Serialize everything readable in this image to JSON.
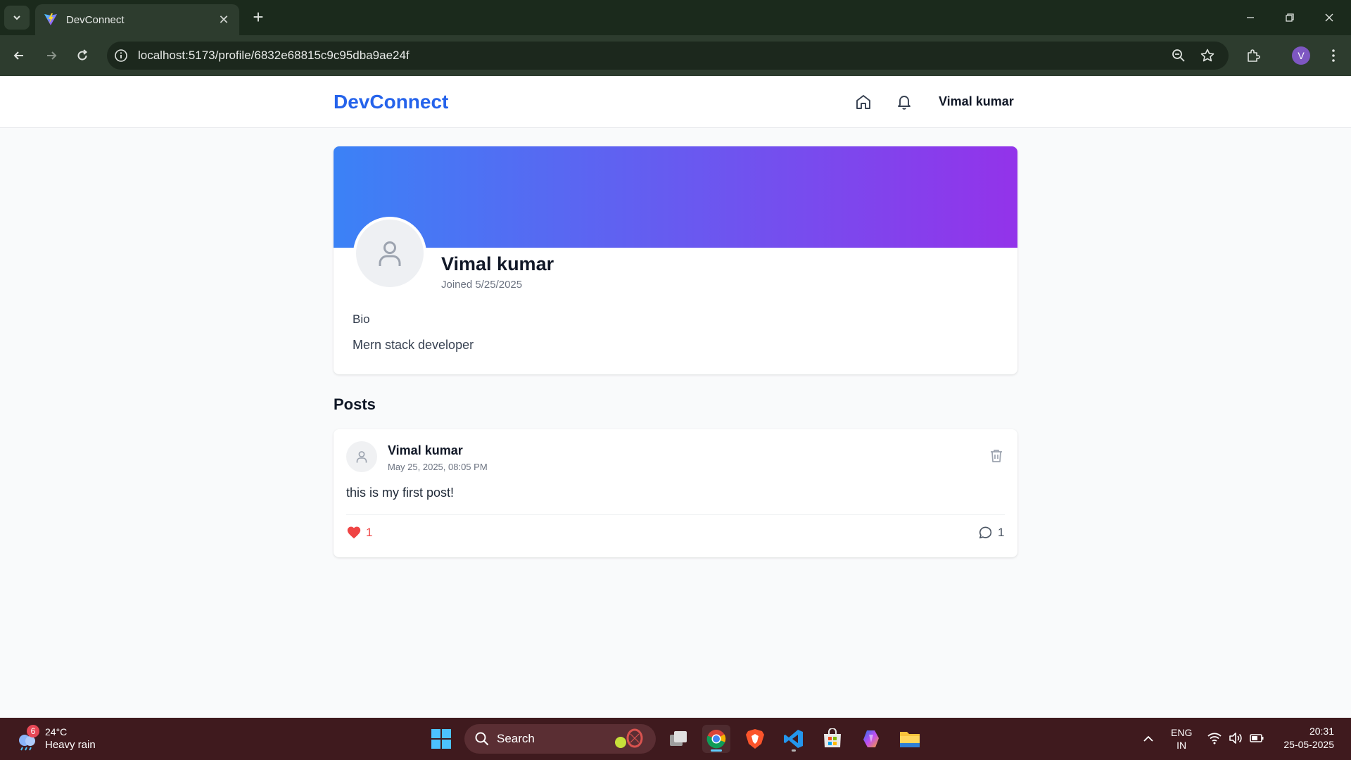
{
  "browser": {
    "tab_title": "DevConnect",
    "url": "localhost:5173/profile/6832e68815c9c95dba9ae24f",
    "profile_initial": "V"
  },
  "site": {
    "brand": "DevConnect",
    "header_user": "Vimal kumar"
  },
  "profile": {
    "name": "Vimal kumar",
    "joined": "Joined 5/25/2025",
    "bio_label": "Bio",
    "bio": "Mern stack developer",
    "cover_gradient": [
      "#3b82f6",
      "#9333ea"
    ]
  },
  "posts_section": {
    "heading": "Posts",
    "posts": [
      {
        "author": "Vimal kumar",
        "date": "May 25, 2025, 08:05 PM",
        "content": "this is my first post!",
        "likes": "1",
        "comments": "1"
      }
    ]
  },
  "taskbar": {
    "weather_temp": "24°C",
    "weather_desc": "Heavy rain",
    "weather_badge": "6",
    "search_label": "Search",
    "lang_line1": "ENG",
    "lang_line2": "IN",
    "time": "20:31",
    "date": "25-05-2025"
  },
  "colors": {
    "brand": "#2563eb",
    "like": "#ef4444",
    "taskbar": "#3f1a1e",
    "chrome": "#2d3c2e"
  },
  "icons": [
    "tab-list-icon",
    "vite-favicon-icon",
    "close-icon",
    "plus-icon",
    "minimize-icon",
    "restore-icon",
    "window-close-icon",
    "back-icon",
    "forward-icon",
    "reload-icon",
    "site-info-icon",
    "zoom-icon",
    "bookmark-star-icon",
    "extensions-icon",
    "more-icon",
    "home-icon",
    "bell-icon",
    "user-icon",
    "trash-icon",
    "heart-icon",
    "comment-icon",
    "windows-start-icon",
    "search-icon",
    "task-view-icon",
    "chrome-icon",
    "brave-icon",
    "vscode-icon",
    "store-icon",
    "copilot-icon",
    "file-explorer-icon",
    "chevron-up-icon",
    "wifi-icon",
    "volume-icon",
    "battery-icon"
  ]
}
